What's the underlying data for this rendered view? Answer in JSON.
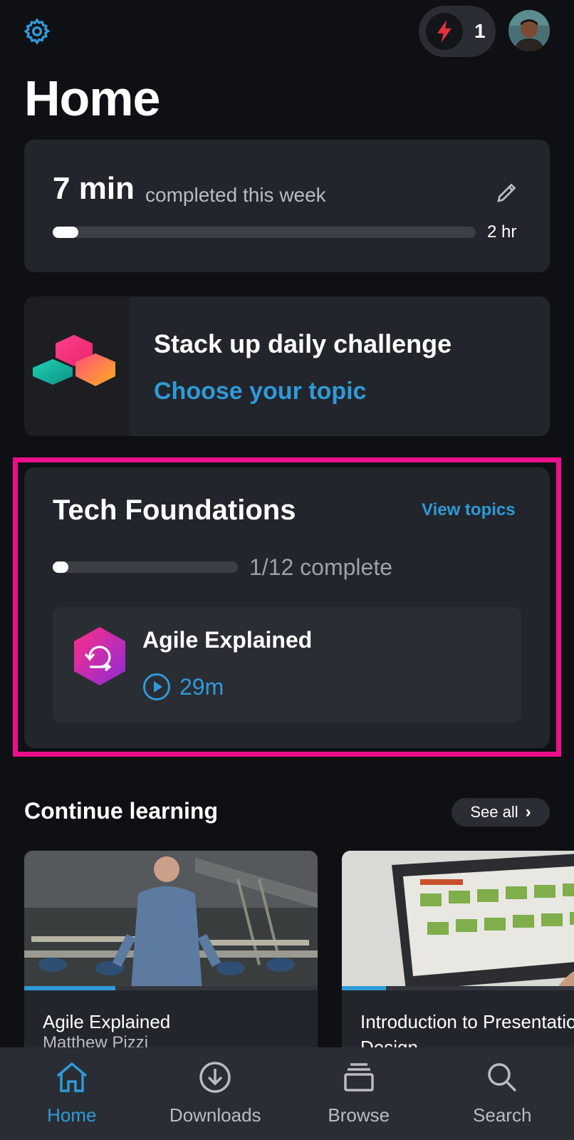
{
  "header": {
    "title": "Home",
    "streak_count": "1",
    "settings_icon": "gear-icon",
    "streak_icon": "lightning-icon"
  },
  "weekly": {
    "minutes": "7 min",
    "subtitle": "completed this week",
    "goal": "2 hr",
    "progress_fraction": 0.06
  },
  "challenge": {
    "title": "Stack up daily challenge",
    "link": "Choose your topic"
  },
  "path": {
    "title": "Tech Foundations",
    "view_topics": "View topics",
    "progress_text": "1/12 complete",
    "progress_fraction": 0.0833,
    "course": {
      "title": "Agile Explained",
      "duration": "29m"
    }
  },
  "continue": {
    "title": "Continue learning",
    "see_all": "See all",
    "cards": [
      {
        "title": "Agile Explained",
        "author": "Matthew Pizzi",
        "progress_fraction": 0.31
      },
      {
        "title": "Introduction to Presentation Design",
        "author": "",
        "progress_fraction": 0.15
      }
    ]
  },
  "nav": {
    "items": [
      {
        "label": "Home",
        "icon": "home-icon"
      },
      {
        "label": "Downloads",
        "icon": "download-icon"
      },
      {
        "label": "Browse",
        "icon": "browse-icon"
      },
      {
        "label": "Search",
        "icon": "search-icon"
      }
    ]
  },
  "colors": {
    "accent": "#2f9ad8",
    "highlight": "#ec0f8c",
    "background": "#0f1014",
    "card": "#22252b"
  }
}
